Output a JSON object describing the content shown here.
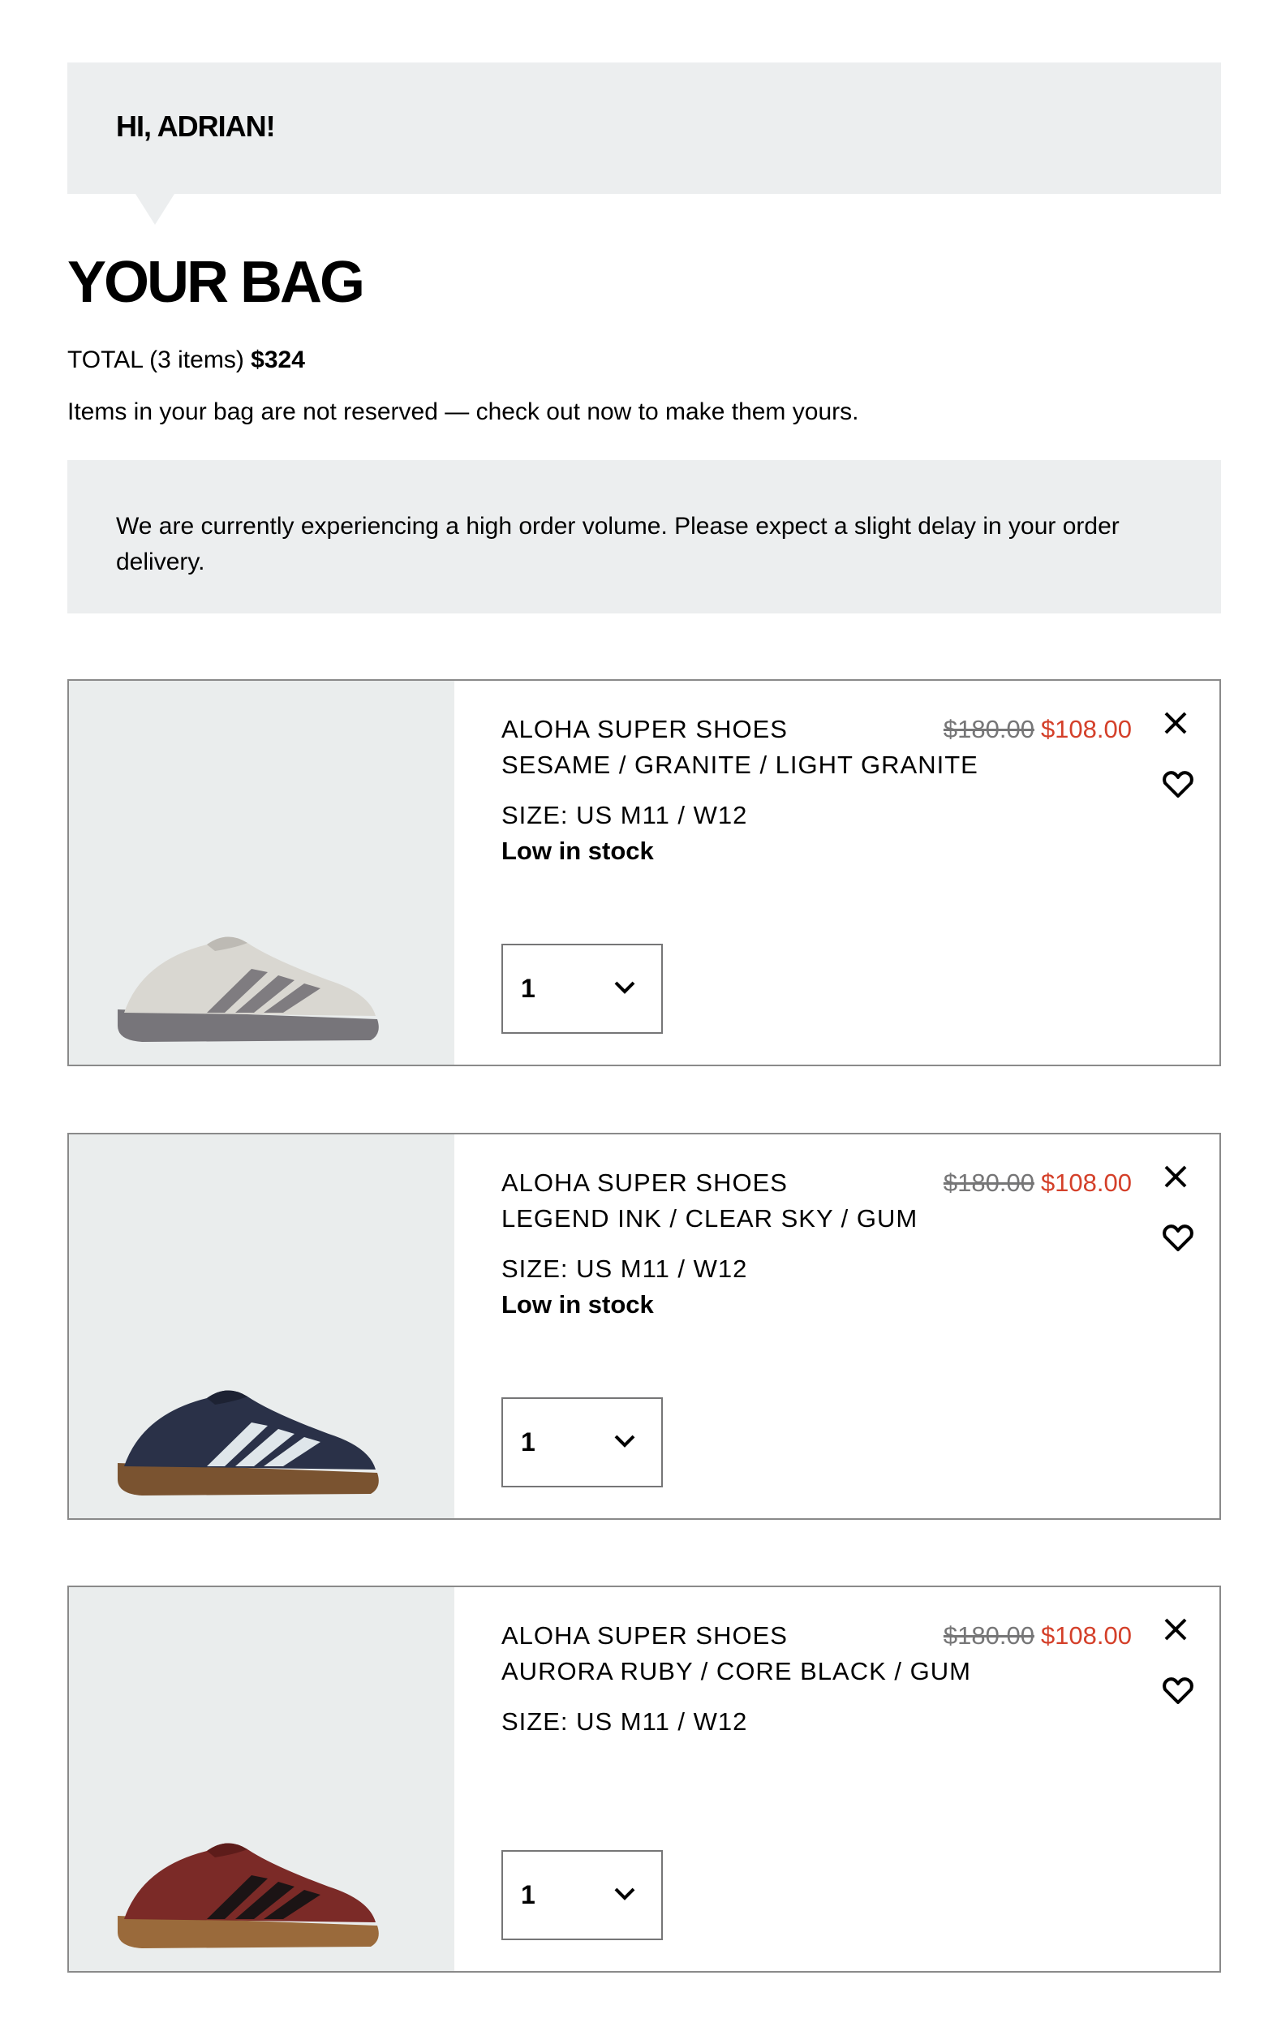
{
  "greeting": {
    "text": "HI, ADRIAN!"
  },
  "bag": {
    "title": "YOUR BAG",
    "total_label": "TOTAL (3 items)",
    "total_amount": "$324",
    "reserve_note": "Items in your bag are not reserved — check out now to make them yours."
  },
  "notice": {
    "text": "We are currently experiencing a high order volume. Please expect a slight delay in your order delivery."
  },
  "items": [
    {
      "name": "ALOHA SUPER SHOES",
      "color": "SESAME / GRANITE / LIGHT GRANITE",
      "size": "SIZE: US M11 / W12",
      "stock": "Low in stock",
      "original_price": "$180.00",
      "sale_price": "$108.00",
      "quantity": "1",
      "shoe_colors": {
        "upper": "#d9d7d1",
        "stripes": "#7f7c80",
        "sole": "#77757a",
        "trim": "#bdbab4"
      }
    },
    {
      "name": "ALOHA SUPER SHOES",
      "color": "LEGEND INK / CLEAR SKY / GUM",
      "size": "SIZE: US M11 / W12",
      "stock": "Low in stock",
      "original_price": "$180.00",
      "sale_price": "$108.00",
      "quantity": "1",
      "shoe_colors": {
        "upper": "#2a3148",
        "stripes": "#dfe6ea",
        "sole": "#7a5330",
        "trim": "#1d2233"
      }
    },
    {
      "name": "ALOHA SUPER SHOES",
      "color": "AURORA RUBY / CORE BLACK / GUM",
      "size": "SIZE: US M11 / W12",
      "stock": "",
      "original_price": "$180.00",
      "sale_price": "$108.00",
      "quantity": "1",
      "shoe_colors": {
        "upper": "#7b2a27",
        "stripes": "#1b1415",
        "sole": "#9a6a3b",
        "trim": "#5d1c1a"
      }
    }
  ],
  "icons": {
    "remove": "close-icon",
    "wishlist": "heart-icon",
    "dropdown": "chevron-down-icon"
  },
  "colors": {
    "panel_bg": "#eceeef",
    "sale_red": "#d4402a",
    "strike_gray": "#767677"
  }
}
